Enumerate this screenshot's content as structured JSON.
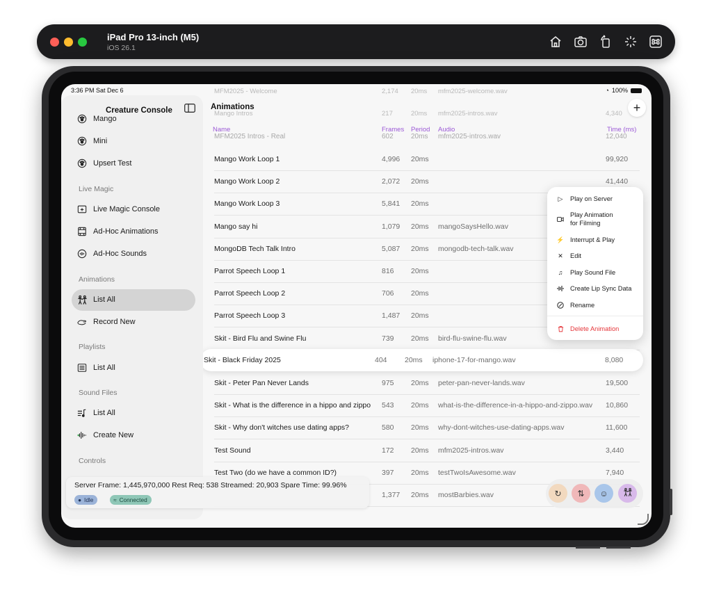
{
  "simulator": {
    "device_name": "iPad Pro 13-inch (M5)",
    "os_version": "iOS 26.1",
    "tools": [
      "home-icon",
      "screenshot-icon",
      "rotate-icon",
      "shake-icon",
      "command-icon"
    ]
  },
  "status_bar": {
    "time": "3:36 PM  Sat Dec 6",
    "battery": "100%"
  },
  "sidebar": {
    "title": "Creature Console",
    "creatures": [
      "Mango",
      "Mini",
      "Upsert Test"
    ],
    "sections": {
      "live_magic": "Live Magic",
      "animations": "Animations",
      "playlists": "Playlists",
      "sound_files": "Sound Files",
      "controls": "Controls"
    },
    "live_magic_items": [
      "Live Magic Console",
      "Ad-Hoc Animations",
      "Ad-Hoc Sounds"
    ],
    "animations_items": [
      "List All",
      "Record New"
    ],
    "playlists_items": [
      "List All"
    ],
    "sound_files_items": [
      "List All",
      "Create New"
    ]
  },
  "content": {
    "title": "Animations",
    "ghost_rows": [
      [
        "MFM2025 - Welcome",
        "2,174",
        "20ms",
        "mfm2025-welcome.wav"
      ],
      [
        "Mango Intros",
        "217",
        "20ms",
        "mfm2025-intros.wav",
        "4,340"
      ]
    ],
    "headers": {
      "name": "Name",
      "frames": "Frames",
      "period": "Period",
      "audio": "Audio",
      "time": "Time (ms)"
    },
    "header_overlap_row": [
      "MFM2025 Intros - Real",
      "602",
      "20ms",
      "mfm2025-intros.wav",
      "12,040"
    ],
    "rows": [
      {
        "name": "Mango Work Loop 1",
        "frames": "4,996",
        "period": "20ms",
        "audio": "",
        "time": "99,920"
      },
      {
        "name": "Mango Work Loop 2",
        "frames": "2,072",
        "period": "20ms",
        "audio": "",
        "time": "41,440"
      },
      {
        "name": "Mango Work Loop 3",
        "frames": "5,841",
        "period": "20ms",
        "audio": "",
        "time": ""
      },
      {
        "name": "Mango say hi",
        "frames": "1,079",
        "period": "20ms",
        "audio": "mangoSaysHello.wav",
        "time": ""
      },
      {
        "name": "MongoDB Tech Talk Intro",
        "frames": "5,087",
        "period": "20ms",
        "audio": "mongodb-tech-talk.wav",
        "time": ""
      },
      {
        "name": "Parrot Speech Loop 1",
        "frames": "816",
        "period": "20ms",
        "audio": "",
        "time": ""
      },
      {
        "name": "Parrot Speech Loop 2",
        "frames": "706",
        "period": "20ms",
        "audio": "",
        "time": ""
      },
      {
        "name": "Parrot Speech Loop 3",
        "frames": "1,487",
        "period": "20ms",
        "audio": "",
        "time": ""
      },
      {
        "name": "Skit - Bird Flu and Swine Flu",
        "frames": "739",
        "period": "20ms",
        "audio": "bird-flu-swine-flu.wav",
        "time": ""
      },
      {
        "name": "Skit - Black Friday 2025",
        "frames": "404",
        "period": "20ms",
        "audio": "iphone-17-for-mango.wav",
        "time": "8,080"
      },
      {
        "name": "Skit - Peter Pan Never Lands",
        "frames": "975",
        "period": "20ms",
        "audio": "peter-pan-never-lands.wav",
        "time": "19,500"
      },
      {
        "name": "Skit - What is the difference in a hippo and zippo",
        "frames": "543",
        "period": "20ms",
        "audio": "what-is-the-difference-in-a-hippo-and-zippo.wav",
        "time": "10,860"
      },
      {
        "name": "Skit - Why don't witches use dating apps?",
        "frames": "580",
        "period": "20ms",
        "audio": "why-dont-witches-use-dating-apps.wav",
        "time": "11,600"
      },
      {
        "name": "Test Sound",
        "frames": "172",
        "period": "20ms",
        "audio": "mfm2025-intros.wav",
        "time": "3,440"
      },
      {
        "name": "Test Two (do we have a common ID?)",
        "frames": "397",
        "period": "20ms",
        "audio": "testTwoIsAwesome.wav",
        "time": "7,940"
      },
      {
        "name": "",
        "frames": "1,377",
        "period": "20ms",
        "audio": "mostBarbies.wav",
        "time": ""
      }
    ]
  },
  "context_menu": {
    "items": [
      {
        "label": "Play on Server",
        "icon": "play-icon"
      },
      {
        "label": "Play Animation\nfor Filming",
        "icon": "video-icon"
      },
      {
        "label": "Interrupt & Play",
        "icon": "bolt-icon"
      },
      {
        "label": "Edit",
        "icon": "pencil-icon"
      },
      {
        "label": "Play Sound File",
        "icon": "music-notes-icon"
      },
      {
        "label": "Create Lip Sync Data",
        "icon": "waveform-icon"
      },
      {
        "label": "Rename",
        "icon": "rename-icon"
      }
    ],
    "delete_label": "Delete Animation"
  },
  "footer": {
    "stats": "Server Frame: 1,445,970,000   Rest Req: 538   Streamed: 20,903   Spare Time: 99.96%",
    "idle_label": "Idle",
    "connected_label": "Connected"
  },
  "colors": {
    "accent_purple": "#9b59d6",
    "danger": "#e5373b",
    "badge_idle": "#9bb3d8",
    "badge_connected": "#8fc7b7"
  }
}
